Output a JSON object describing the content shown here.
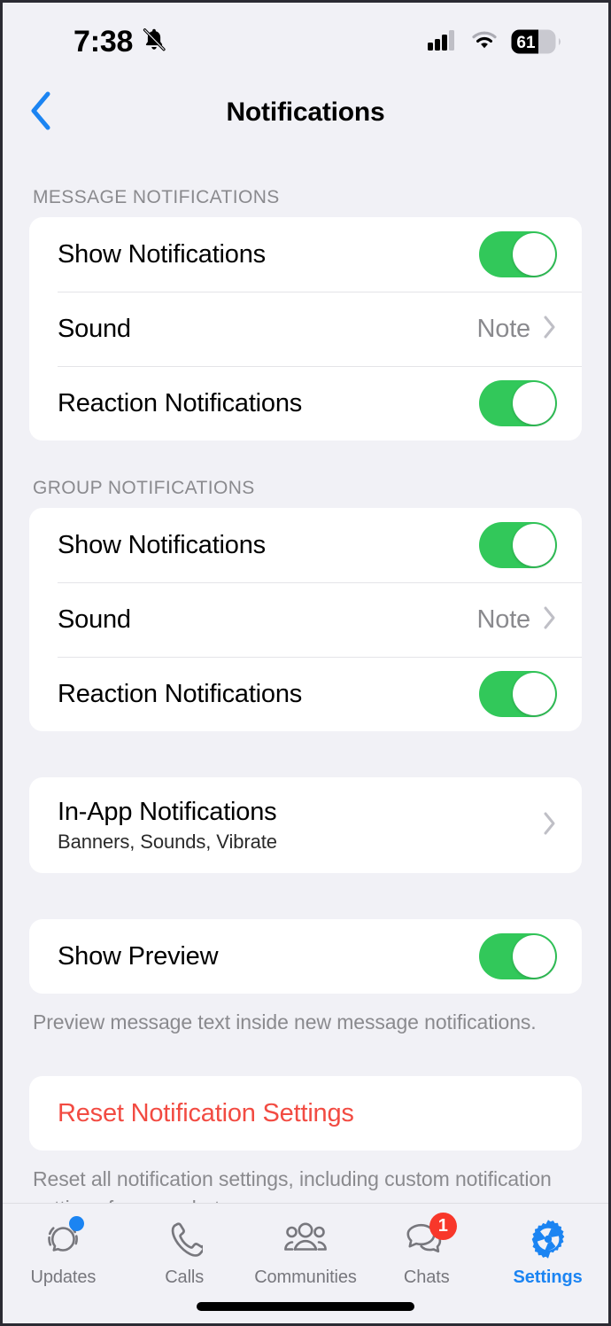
{
  "status_bar": {
    "time": "7:38",
    "silent_icon": "bell-slash-icon",
    "cellular_icon": "cellular-bars-icon",
    "wifi_icon": "wifi-icon",
    "battery_level": "61"
  },
  "nav": {
    "back_icon": "chevron-left-icon",
    "title": "Notifications"
  },
  "sections": {
    "message": {
      "header": "MESSAGE NOTIFICATIONS",
      "show_notifications_label": "Show Notifications",
      "show_notifications_value": "on",
      "sound_label": "Sound",
      "sound_value": "Note",
      "reaction_label": "Reaction Notifications",
      "reaction_value": "on"
    },
    "group": {
      "header": "GROUP NOTIFICATIONS",
      "show_notifications_label": "Show Notifications",
      "show_notifications_value": "on",
      "sound_label": "Sound",
      "sound_value": "Note",
      "reaction_label": "Reaction Notifications",
      "reaction_value": "on"
    },
    "in_app": {
      "title": "In-App Notifications",
      "subtitle": "Banners, Sounds, Vibrate"
    },
    "preview": {
      "label": "Show Preview",
      "value": "on",
      "footer": "Preview message text inside new message notifications."
    },
    "reset": {
      "label": "Reset Notification Settings",
      "footer": "Reset all notification settings, including custom notification settings for your chats."
    }
  },
  "tabs": [
    {
      "label": "Updates",
      "icon": "updates-ring-icon",
      "badge": "dot",
      "active": false
    },
    {
      "label": "Calls",
      "icon": "phone-icon",
      "badge": "",
      "active": false
    },
    {
      "label": "Communities",
      "icon": "communities-people-icon",
      "badge": "",
      "active": false
    },
    {
      "label": "Chats",
      "icon": "chat-bubbles-icon",
      "badge": "1",
      "active": false
    },
    {
      "label": "Settings",
      "icon": "gear-icon",
      "badge": "",
      "active": true
    }
  ],
  "colors": {
    "toggle_on": "#32C85A",
    "accent_blue": "#1B84F2",
    "destructive_red": "#F24B42",
    "badge_red": "#F8372A",
    "background": "#F1F1F6"
  }
}
